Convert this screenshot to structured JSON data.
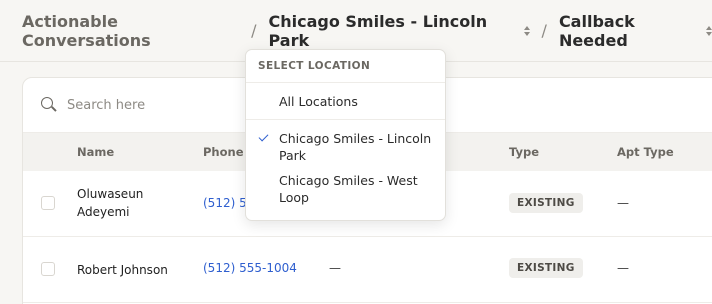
{
  "breadcrumb": {
    "root": "Actionable Conversations",
    "separator": "/",
    "location": "Chicago Smiles - Lincoln Park",
    "filter": "Callback Needed"
  },
  "search": {
    "placeholder": "Search here"
  },
  "table": {
    "columns": [
      "Name",
      "Phone",
      "Type",
      "Apt Type"
    ],
    "rows": [
      {
        "name": "Oluwaseun Adeyemi",
        "phone": "(512) 555",
        "type": "EXISTING",
        "apt_type": "—"
      },
      {
        "name": "Robert Johnson",
        "phone": "(512) 555-1004",
        "extra": "—",
        "type": "EXISTING",
        "apt_type": "—"
      }
    ]
  },
  "dropdown": {
    "title": "SELECT LOCATION",
    "options": [
      {
        "label": "All Locations",
        "selected": false
      },
      {
        "label": "Chicago Smiles - Lincoln Park",
        "selected": true
      },
      {
        "label": "Chicago Smiles - West Loop",
        "selected": false
      }
    ]
  },
  "colors": {
    "link": "#2f5fcf",
    "background": "#f7f6f3"
  }
}
